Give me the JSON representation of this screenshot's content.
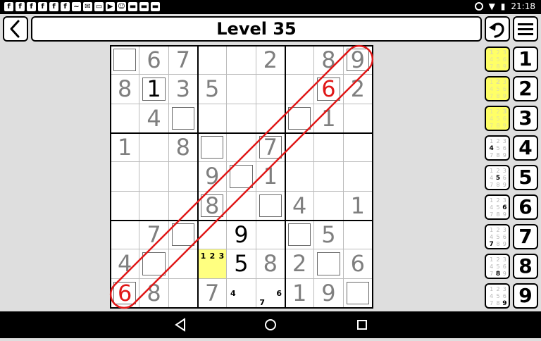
{
  "status_bar": {
    "left_icons": [
      "f",
      "f",
      "f",
      "f",
      "f",
      "f",
      "~",
      "✉",
      "▭",
      "▶",
      "☺",
      "▬",
      "▬",
      "▬"
    ],
    "time": "21:18"
  },
  "header": {
    "title": "Level 35",
    "back_icon": "chevron-left-icon",
    "undo_icon": "undo-icon",
    "menu_icon": "hamburger-menu-icon"
  },
  "board": {
    "note": "9x9 grid; kind: given (gray), user (black), error (red), box = empty selected-style cell, notes = pencil marks",
    "rows": [
      [
        {
          "k": "box"
        },
        {
          "v": "6",
          "k": "given"
        },
        {
          "v": "7",
          "k": "given"
        },
        {
          "k": "empty"
        },
        {
          "k": "empty"
        },
        {
          "v": "2",
          "k": "given"
        },
        {
          "k": "empty"
        },
        {
          "v": "8",
          "k": "given"
        },
        {
          "v": "9",
          "k": "given",
          "box": true
        }
      ],
      [
        {
          "v": "8",
          "k": "given"
        },
        {
          "v": "1",
          "k": "user",
          "box": true
        },
        {
          "v": "3",
          "k": "given"
        },
        {
          "v": "5",
          "k": "given"
        },
        {
          "k": "empty"
        },
        {
          "k": "empty"
        },
        {
          "k": "empty"
        },
        {
          "v": "6",
          "k": "error",
          "box": true
        },
        {
          "v": "2",
          "k": "given"
        }
      ],
      [
        {
          "k": "empty"
        },
        {
          "v": "4",
          "k": "given"
        },
        {
          "k": "box"
        },
        {
          "k": "empty"
        },
        {
          "k": "empty"
        },
        {
          "k": "empty"
        },
        {
          "k": "box"
        },
        {
          "v": "1",
          "k": "given"
        },
        {
          "k": "empty"
        }
      ],
      [
        {
          "v": "1",
          "k": "given"
        },
        {
          "k": "empty"
        },
        {
          "v": "8",
          "k": "given"
        },
        {
          "k": "box"
        },
        {
          "k": "empty"
        },
        {
          "v": "7",
          "k": "given",
          "box": true
        },
        {
          "k": "empty"
        },
        {
          "k": "empty"
        },
        {
          "k": "empty"
        }
      ],
      [
        {
          "k": "empty"
        },
        {
          "k": "empty"
        },
        {
          "k": "empty"
        },
        {
          "v": "9",
          "k": "given"
        },
        {
          "k": "box"
        },
        {
          "v": "1",
          "k": "given"
        },
        {
          "k": "empty"
        },
        {
          "k": "empty"
        },
        {
          "k": "empty"
        }
      ],
      [
        {
          "k": "empty"
        },
        {
          "k": "empty"
        },
        {
          "k": "empty"
        },
        {
          "v": "8",
          "k": "given",
          "box": true
        },
        {
          "k": "empty"
        },
        {
          "k": "box"
        },
        {
          "v": "4",
          "k": "given"
        },
        {
          "k": "empty"
        },
        {
          "v": "1",
          "k": "given"
        }
      ],
      [
        {
          "k": "empty"
        },
        {
          "v": "7",
          "k": "given"
        },
        {
          "k": "box"
        },
        {
          "k": "empty"
        },
        {
          "v": "9",
          "k": "user"
        },
        {
          "k": "empty"
        },
        {
          "k": "box"
        },
        {
          "v": "5",
          "k": "given"
        },
        {
          "k": "empty"
        }
      ],
      [
        {
          "v": "4",
          "k": "given"
        },
        {
          "k": "box"
        },
        {
          "k": "empty"
        },
        {
          "k": "highlight",
          "notes": [
            "1",
            "2",
            "3"
          ]
        },
        {
          "v": "5",
          "k": "user"
        },
        {
          "v": "8",
          "k": "given"
        },
        {
          "v": "2",
          "k": "given"
        },
        {
          "k": "box"
        },
        {
          "v": "6",
          "k": "given"
        }
      ],
      [
        {
          "v": "6",
          "k": "error",
          "box": true
        },
        {
          "v": "8",
          "k": "given"
        },
        {
          "k": "empty"
        },
        {
          "v": "7",
          "k": "given"
        },
        {
          "k": "empty",
          "notes_corner": [
            {
              "t": "4",
              "pos": "ml"
            }
          ]
        },
        {
          "k": "empty",
          "notes_corner": [
            {
              "t": "7",
              "pos": "bl"
            },
            {
              "t": "6",
              "pos": "mr"
            }
          ]
        },
        {
          "v": "1",
          "k": "given"
        },
        {
          "v": "9",
          "k": "given"
        },
        {
          "k": "box"
        }
      ]
    ]
  },
  "pencil_buttons": [
    {
      "digit": "1",
      "active": true
    },
    {
      "digit": "2",
      "active": true
    },
    {
      "digit": "3",
      "active": true
    },
    {
      "digit": "4",
      "active": false
    },
    {
      "digit": "5",
      "active": false
    },
    {
      "digit": "6",
      "active": false
    },
    {
      "digit": "7",
      "active": false
    },
    {
      "digit": "8",
      "active": false
    },
    {
      "digit": "9",
      "active": false
    }
  ],
  "number_buttons": [
    "1",
    "2",
    "3",
    "4",
    "5",
    "6",
    "7",
    "8",
    "9"
  ],
  "mini_digits": [
    "1",
    "2",
    "3",
    "4",
    "5",
    "6",
    "7",
    "8",
    "9"
  ],
  "nav_bar": {
    "back_icon": "triangle-back-icon",
    "home_icon": "circle-home-icon",
    "recents_icon": "square-recents-icon"
  },
  "colors": {
    "background": "#dedede",
    "given": "#7f7f7f",
    "user": "#000000",
    "error": "#e01818",
    "highlight": "#ffff80",
    "active_pencil": "#ffff66",
    "diagonal": "#e01818"
  }
}
